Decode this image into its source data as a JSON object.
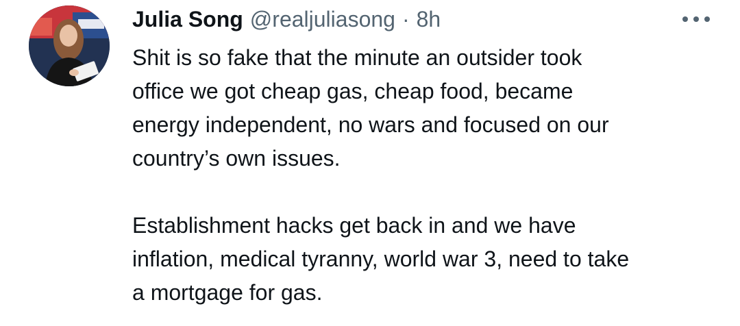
{
  "tweet": {
    "author": {
      "display_name": "Julia Song",
      "handle": "@realjuliasong",
      "avatar_icon": "profile-photo"
    },
    "separator": "·",
    "timestamp": "8h",
    "more_icon": "more-horizontal-icon",
    "paragraphs": [
      [
        "Shit is so fake that the minute an outsider took",
        "office we got cheap gas, cheap food, became",
        "energy independent, no wars and focused on our",
        "country’s own issues."
      ],
      [
        "Establishment hacks get back in and we have",
        "inflation, medical tyranny, world war 3, need to take",
        "a mortgage for gas."
      ]
    ]
  }
}
